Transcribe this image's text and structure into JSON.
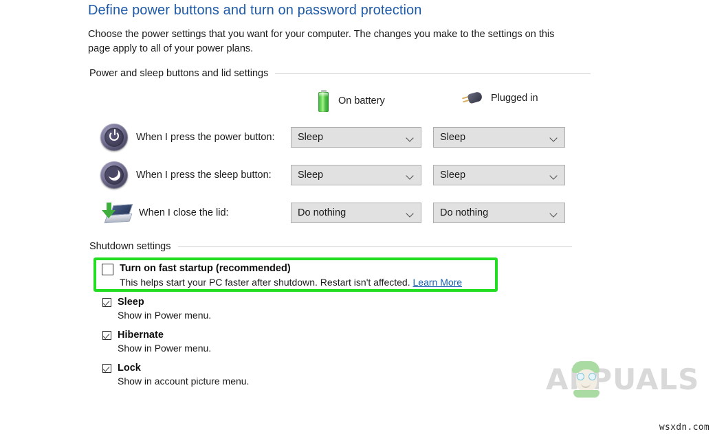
{
  "header": {
    "title": "Define power buttons and turn on password protection",
    "description": "Choose the power settings that you want for your computer. The changes you make to the settings on this page apply to all of your power plans."
  },
  "sections": {
    "power_lid": {
      "label": "Power and sleep buttons and lid settings",
      "columns": [
        {
          "label": "On battery",
          "icon": "battery-icon"
        },
        {
          "label": "Plugged in",
          "icon": "power-plug-icon"
        }
      ],
      "rows": [
        {
          "icon": "power-button-icon",
          "label": "When I press the power button:",
          "on_battery": "Sleep",
          "plugged_in": "Sleep"
        },
        {
          "icon": "sleep-moon-icon",
          "label": "When I press the sleep button:",
          "on_battery": "Sleep",
          "plugged_in": "Sleep"
        },
        {
          "icon": "laptop-lid-icon",
          "label": "When I close the lid:",
          "on_battery": "Do nothing",
          "plugged_in": "Do nothing"
        }
      ]
    },
    "shutdown": {
      "label": "Shutdown settings",
      "options": [
        {
          "title": "Turn on fast startup (recommended)",
          "description": "This helps start your PC faster after shutdown. Restart isn't affected.",
          "link_text": "Learn More",
          "checked": false,
          "highlighted": true
        },
        {
          "title": "Sleep",
          "description": "Show in Power menu.",
          "checked": true,
          "highlighted": false
        },
        {
          "title": "Hibernate",
          "description": "Show in Power menu.",
          "checked": true,
          "highlighted": false
        },
        {
          "title": "Lock",
          "description": "Show in account picture menu.",
          "checked": true,
          "highlighted": false
        }
      ]
    }
  },
  "watermark": {
    "brand": "APPUALS",
    "source": "wsxdn.com"
  },
  "colors": {
    "title_blue": "#1e5aa8",
    "highlight_green": "#22dd22",
    "link_blue": "#1b5fb0",
    "dropdown_bg": "#e1e1e1",
    "dropdown_border": "#adadad"
  }
}
